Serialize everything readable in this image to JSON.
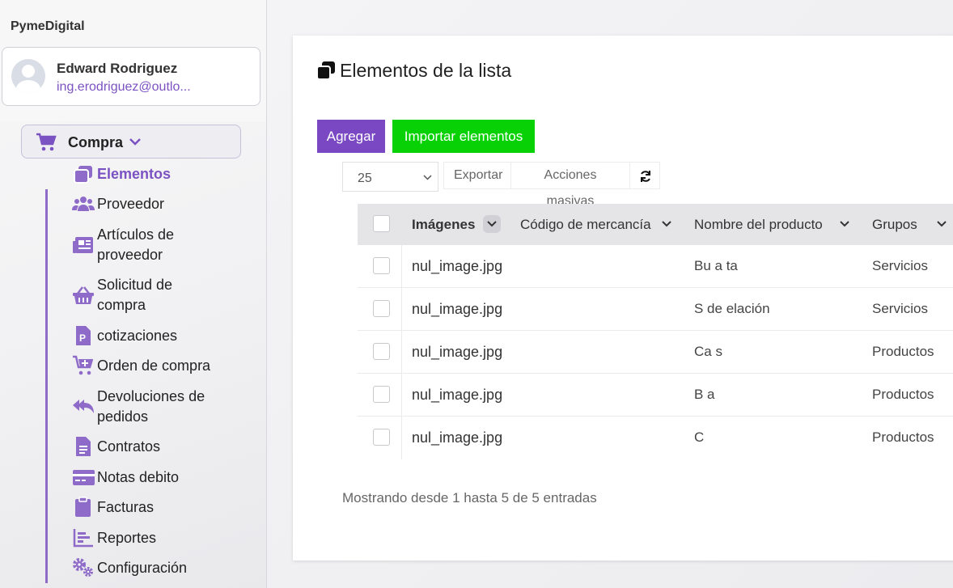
{
  "app": {
    "brand": "PymeDigital"
  },
  "profile": {
    "name": "Edward Rodriguez",
    "email": "ing.erodriguez@outlo..."
  },
  "menu": {
    "section_label": "Compra",
    "items": [
      {
        "label": "Elementos",
        "icon": "copy-icon",
        "active": true
      },
      {
        "label": "Proveedor",
        "icon": "users-icon"
      },
      {
        "label": "Artículos de proveedor",
        "line1": "Artículos de",
        "line2": "proveedor",
        "icon": "newspaper-icon"
      },
      {
        "label": "Solicitud de compra",
        "line1": "Solicitud de",
        "line2": "compra",
        "icon": "basket-icon"
      },
      {
        "label": "cotizaciones",
        "icon": "file-p-icon"
      },
      {
        "label": "Orden de compra",
        "icon": "cart-plus-icon"
      },
      {
        "label": "Devoluciones de pedidos",
        "line1": "Devoluciones de",
        "line2": "pedidos",
        "icon": "reply-all-icon"
      },
      {
        "label": "Contratos",
        "icon": "file-text-icon"
      },
      {
        "label": "Notas debito",
        "icon": "credit-card-icon"
      },
      {
        "label": "Facturas",
        "icon": "clipboard-icon"
      },
      {
        "label": "Reportes",
        "icon": "chart-icon"
      },
      {
        "label": "Configuración",
        "icon": "cogs-icon"
      }
    ]
  },
  "page": {
    "title": "Elementos de la lista",
    "add_button": "Agregar",
    "import_button": "Importar elementos",
    "page_size": "25",
    "export_button": "Exportar",
    "bulk_button": "Acciones masivas",
    "footer": "Mostrando desde 1 hasta 5 de 5 entradas"
  },
  "table": {
    "columns": [
      "Imágenes",
      "Código de mercancía",
      "Nombre del producto",
      "Grupos"
    ],
    "rows": [
      {
        "image": "nul_image.jpg",
        "code": "",
        "name": "Bu   a    ta",
        "group": "Servicios"
      },
      {
        "image": "nul_image.jpg",
        "code": "",
        "name": "S   de  elación",
        "group": "Servicios"
      },
      {
        "image": "nul_image.jpg",
        "code": "",
        "name": "Ca    s",
        "group": "Productos"
      },
      {
        "image": "nul_image.jpg",
        "code": "",
        "name": "B    a",
        "group": "Productos"
      },
      {
        "image": "nul_image.jpg",
        "code": "",
        "name": "C",
        "group": "Productos"
      }
    ]
  },
  "colors": {
    "accent": "#7b52c1",
    "add_button": "#7b48c4",
    "import_button": "#08d206"
  }
}
